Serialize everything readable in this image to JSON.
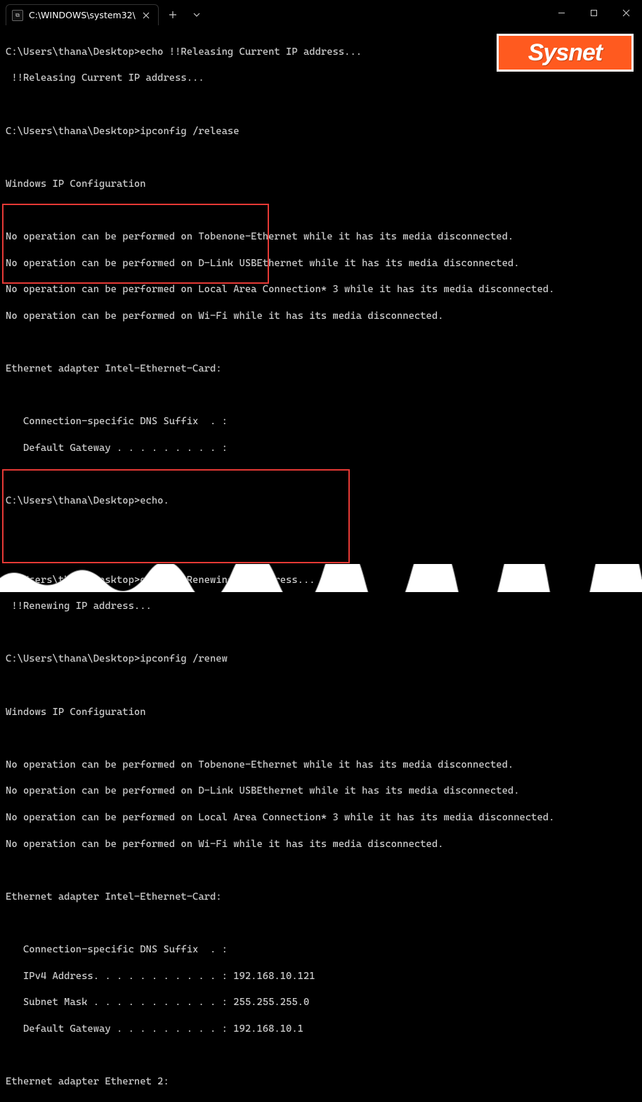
{
  "window": {
    "tab_title": "C:\\WINDOWS\\system32\\",
    "logo_text": "Sysnet"
  },
  "t": {
    "l1": "C:\\Users\\thana\\Desktop>echo !!Releasing Current IP address...",
    "l2": " !!Releasing Current IP address...",
    "l3": "",
    "l4": "C:\\Users\\thana\\Desktop>ipconfig /release",
    "l5": "",
    "l6": "Windows IP Configuration",
    "l7": "",
    "l8": "No operation can be performed on Tobenone-Ethernet while it has its media disconnected.",
    "l9": "No operation can be performed on D-Link USBEthernet while it has its media disconnected.",
    "l10": "No operation can be performed on Local Area Connection* 3 while it has its media disconnected.",
    "l11": "No operation can be performed on Wi-Fi while it has its media disconnected.",
    "l12": "",
    "l13": "Ethernet adapter Intel-Ethernet-Card:",
    "l14": "",
    "l15": "   Connection-specific DNS Suffix  . :",
    "l16": "   Default Gateway . . . . . . . . . :",
    "l17": "",
    "l18": "C:\\Users\\thana\\Desktop>echo.",
    "l19": "",
    "l20": "",
    "l21": "C:\\Users\\thana\\Desktop>echo  !!Renewing IP address...",
    "l22": " !!Renewing IP address...",
    "l23": "",
    "l24": "C:\\Users\\thana\\Desktop>ipconfig /renew",
    "l25": "",
    "l26": "Windows IP Configuration",
    "l27": "",
    "l28": "No operation can be performed on Tobenone-Ethernet while it has its media disconnected.",
    "l29": "No operation can be performed on D-Link USBEthernet while it has its media disconnected.",
    "l30": "No operation can be performed on Local Area Connection* 3 while it has its media disconnected.",
    "l31": "No operation can be performed on Wi-Fi while it has its media disconnected.",
    "l32": "",
    "l33": "Ethernet adapter Intel-Ethernet-Card:",
    "l34": "",
    "l35": "   Connection-specific DNS Suffix  . :",
    "l36": "   IPv4 Address. . . . . . . . . . . : 192.168.10.121",
    "l37": "   Subnet Mask . . . . . . . . . . . : 255.255.255.0",
    "l38": "   Default Gateway . . . . . . . . . : 192.168.10.1",
    "l39": "",
    "l40": "Ethernet adapter Ethernet 2:"
  }
}
